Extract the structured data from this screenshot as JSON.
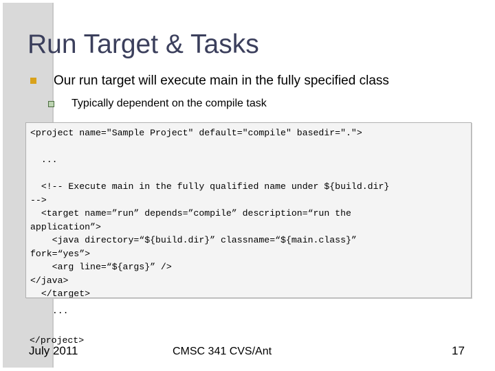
{
  "slide": {
    "title": "Run Target & Tasks",
    "bullets": [
      {
        "marker": "filled-square-marker",
        "marker_color": "#d9a21b",
        "text": "Our run target will execute main in the fully specified class"
      },
      {
        "marker": "hollow-square-marker",
        "marker_color": "#bcd3b1",
        "marker_border_color": "#4a6b3f",
        "text": "Typically dependent on the compile task"
      }
    ],
    "code_block": {
      "background": "#f4f4f4",
      "border_color": "#b0b0b0",
      "lines": [
        "<project name=\"Sample Project\" default=\"compile\" basedir=\".\">",
        "",
        "  ...",
        "",
        "  <!-- Execute main in the fully qualified name under ${build.dir}",
        "-->",
        "  <target name=”run” depends=”compile” description=“run the",
        "application”>",
        "    <java directory=“${build.dir}” classname=“${main.class}”",
        "fork=“yes”>",
        "    <arg line=“${args}” />",
        "</java>",
        "  </target>"
      ],
      "overflow_lines": [
        "  ...",
        "</project>"
      ]
    },
    "footer": {
      "date": "July 2011",
      "center": "CMSC 341 CVS/Ant",
      "page_number": "17"
    },
    "theme": {
      "title_color": "#3b3f5c",
      "sidebar_band_color": "#d9d9d9",
      "body_text_color": "#000000",
      "page_background": "#ffffff"
    }
  }
}
